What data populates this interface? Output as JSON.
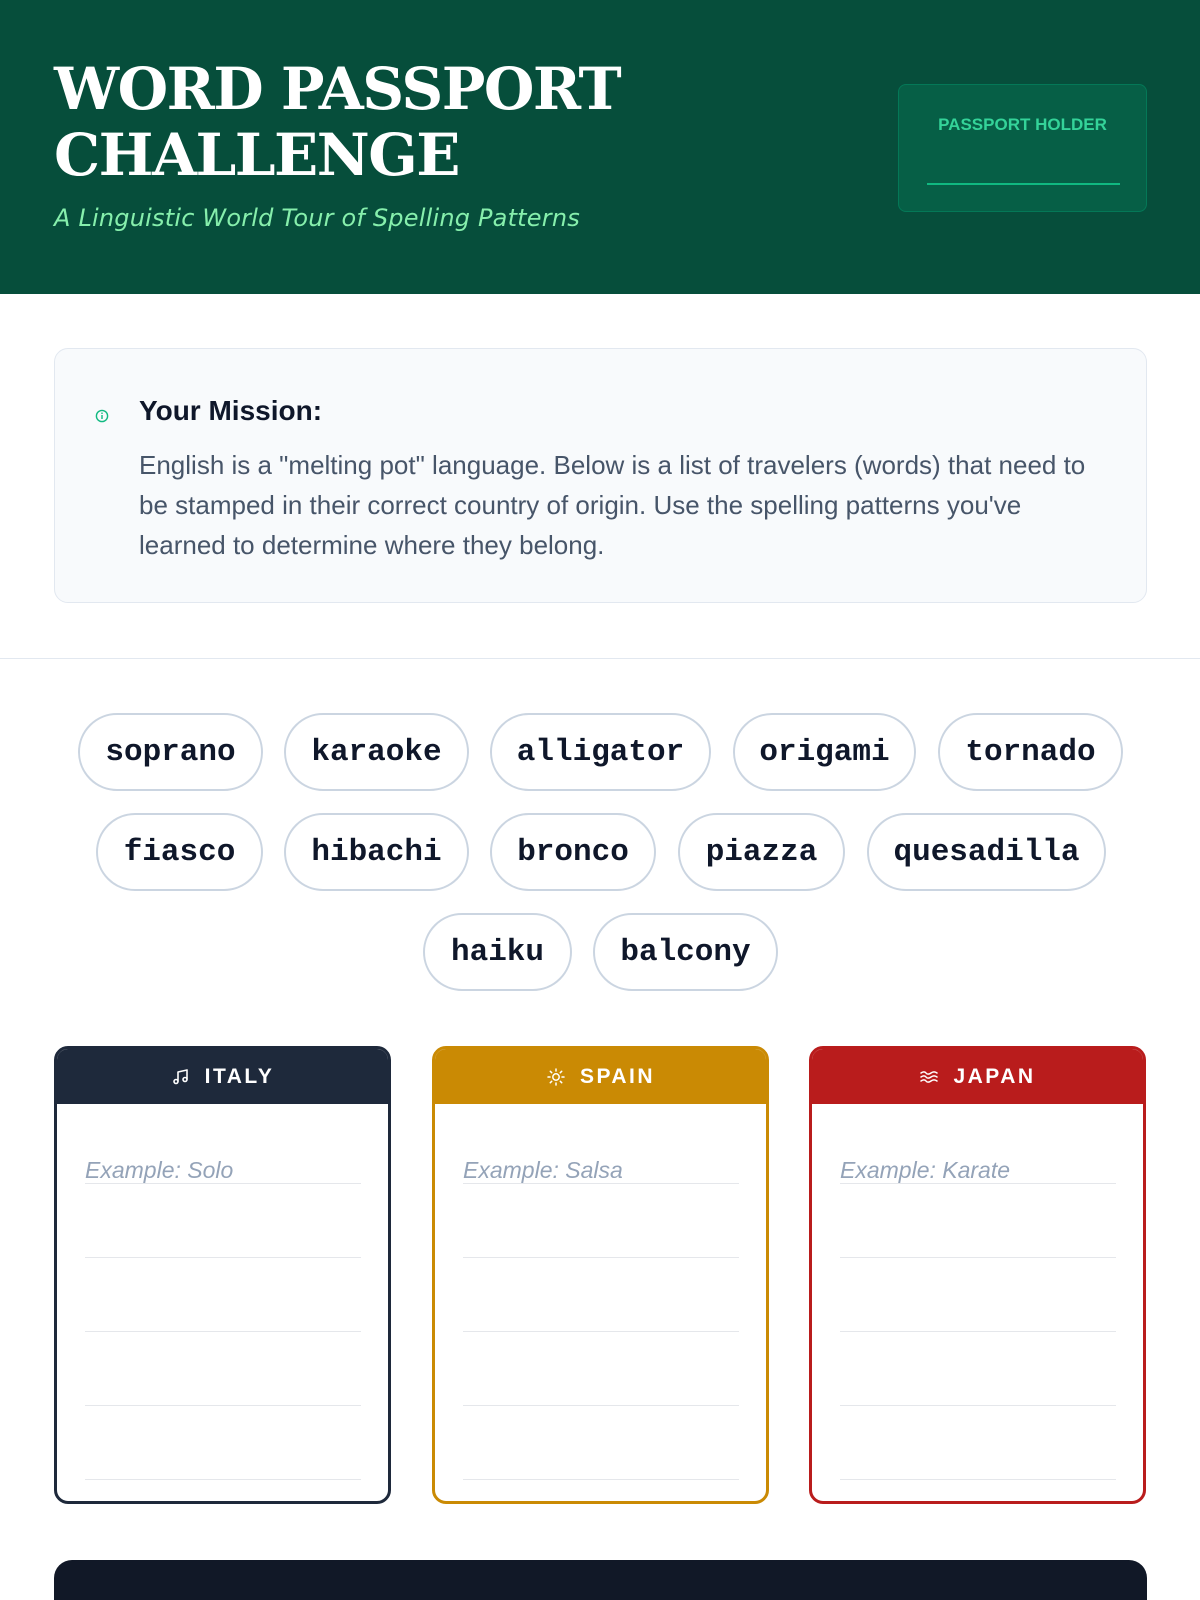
{
  "header": {
    "title": "WORD PASSPORT CHALLENGE",
    "subtitle": "A Linguistic World Tour of Spelling Patterns",
    "holder_label": "PASSPORT HOLDER",
    "holder_value": ""
  },
  "mission": {
    "title": "Your Mission:",
    "text": "English is a \"melting pot\" language. Below is a list of travelers (words) that need to be stamped in their correct country of origin. Use the spelling patterns you've learned to determine where they belong."
  },
  "words": [
    "soprano",
    "karaoke",
    "alligator",
    "origami",
    "tornado",
    "fiasco",
    "hibachi",
    "bronco",
    "piazza",
    "quesadilla",
    "haiku",
    "balcony"
  ],
  "countries": [
    {
      "name": "ITALY",
      "icon": "music-note-icon",
      "color": "#1e293b",
      "placeholder": "Example: Solo"
    },
    {
      "name": "SPAIN",
      "icon": "sun-icon",
      "color": "#ca8a04",
      "placeholder": "Example: Salsa"
    },
    {
      "name": "JAPAN",
      "icon": "waves-icon",
      "color": "#b91c1c",
      "placeholder": "Example: Karate"
    }
  ],
  "colors": {
    "header_bg": "#064e3b",
    "subtitle": "#86efac",
    "holder_label": "#34d399"
  }
}
